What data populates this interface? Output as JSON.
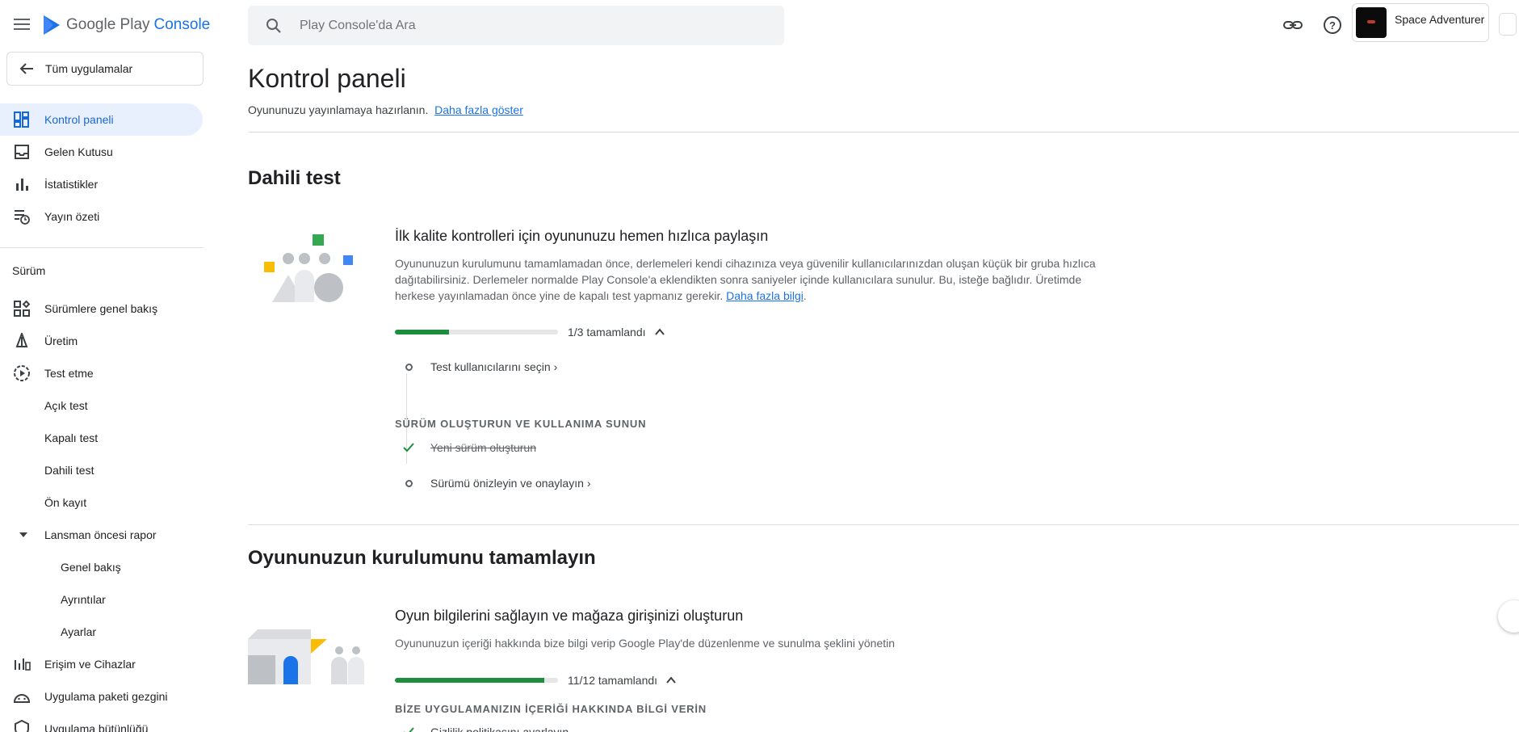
{
  "header": {
    "brand_google": "Google Play",
    "brand_console": "Console",
    "search_placeholder": "Play Console'da Ara",
    "app_name": "Space Adventurer",
    "icons": [
      "menu-icon",
      "play-logo-icon",
      "search-icon",
      "link-icon",
      "help-icon",
      "app-thumbnail",
      "account-icon"
    ]
  },
  "sidebar": {
    "all_apps": "Tüm uygulamalar",
    "items": [
      {
        "label": "Kontrol paneli",
        "icon": "dashboard-icon",
        "active": true
      },
      {
        "label": "Gelen Kutusu",
        "icon": "inbox-icon"
      },
      {
        "label": "İstatistikler",
        "icon": "bar-chart-icon"
      },
      {
        "label": "Yayın özeti",
        "icon": "publishing-icon"
      }
    ],
    "section_release": "Sürüm",
    "release_items": [
      {
        "label": "Sürümlere genel bakış",
        "icon": "releases-overview-icon"
      },
      {
        "label": "Üretim",
        "icon": "production-icon"
      },
      {
        "label": "Test etme",
        "icon": "testing-icon"
      }
    ],
    "testing_sub": [
      "Açık test",
      "Kapalı test",
      "Dahili test",
      "Ön kayıt"
    ],
    "prelaunch": "Lansman öncesi rapor",
    "prelaunch_sub": [
      "Genel bakış",
      "Ayrıntılar",
      "Ayarlar"
    ],
    "more_items": [
      {
        "label": "Erişim ve Cihazlar",
        "icon": "devices-icon"
      },
      {
        "label": "Uygulama paketi gezgini",
        "icon": "android-icon"
      },
      {
        "label": "Uygulama bütünlüğü",
        "icon": "shield-icon"
      }
    ]
  },
  "main": {
    "title": "Kontrol paneli",
    "subtitle": "Oyununuzu yayınlamaya hazırlanın.",
    "show_more": "Daha fazla göster",
    "section1": {
      "title": "Dahili test",
      "card_title": "İlk kalite kontrolleri için oyununuzu hemen hızlıca paylaşın",
      "card_desc": "Oyununuzun kurulumunu tamamlamadan önce, derlemeleri kendi cihazınıza veya güvenilir kullanıcılarınızdan oluşan küçük bir gruba hızlıca dağıtabilirsiniz. Derlemeler normalde Play Console'a eklendikten sonra saniyeler içinde kullanıcılara sunulur. Bu, isteğe bağlıdır. Üretimde herkese yayınlamadan önce yine de kapalı test yapmanız gerekir.",
      "learn_more": "Daha fazla bilgi",
      "progress_text": "1/3 tamamlandı",
      "progress_fraction": 0.333,
      "task1": "Test kullanıcılarını seçin",
      "group_head": "SÜRÜM OLUŞTURUN VE KULLANIMA SUNUN",
      "task2": "Yeni sürüm oluşturun",
      "task3": "Sürümü önizleyin ve onaylayın"
    },
    "section2": {
      "title": "Oyununuzun kurulumunu tamamlayın",
      "card_title": "Oyun bilgilerini sağlayın ve mağaza girişinizi oluşturun",
      "card_desc": "Oyununuzun içeriği hakkında bize bilgi verip Google Play'de düzenlenme ve sunulma şeklini yönetin",
      "progress_text": "11/12 tamamlandı",
      "progress_fraction": 0.917,
      "group_head": "BİZE UYGULAMANIZIN İÇERİĞİ HAKKINDA BİLGİ VERİN",
      "task1": "Gizlilik politikasını ayarlayın"
    }
  },
  "colors": {
    "accent": "#1a73e8",
    "active_bg": "#e8f0fe",
    "progress_fill": "#1e8e3e"
  }
}
